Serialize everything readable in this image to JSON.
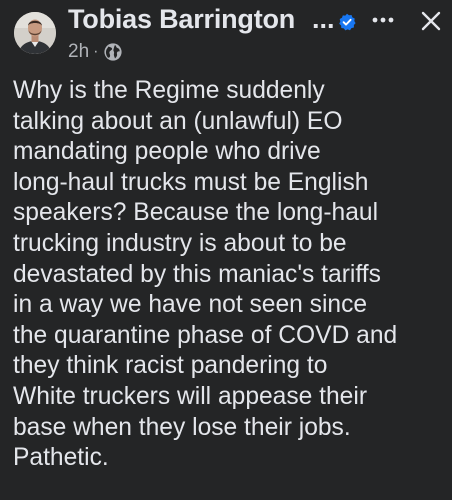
{
  "post": {
    "author": {
      "name": "Tobias Barrington",
      "name_truncation": "...",
      "verified": true
    },
    "timestamp": "2h",
    "separator": "·",
    "audience_icon": "globe-icon",
    "body": "Why is the Regime suddenly\ntalking about an (unlawful) EO\nmandating people who drive\nlong-haul trucks must be English\nspeakers? Because the long-haul\ntrucking industry is about to be\ndevastated by this maniac's tariffs\nin a way we have not seen since\nthe quarantine phase of COVD and\nthey think racist pandering to\nWhite truckers will appease their\nbase when they lose their jobs.\nPathetic."
  },
  "actions": {
    "more_icon": "more-horizontal-icon",
    "close_icon": "close-icon"
  },
  "colors": {
    "background": "#242526",
    "primary_text": "#e4e6eb",
    "secondary_text": "#b0b3b8",
    "verified_badge": "#1877f2"
  }
}
